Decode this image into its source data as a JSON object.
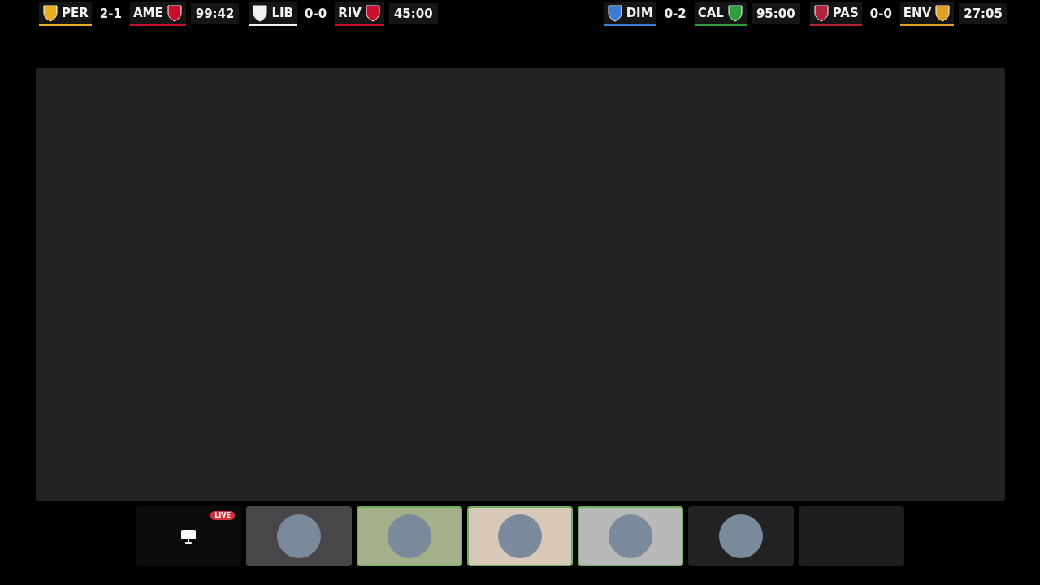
{
  "scoreboard": [
    {
      "home": {
        "abbr": "PER",
        "color": "#e8b020"
      },
      "score": "2-1",
      "away": {
        "abbr": "AME",
        "color": "#c8102e"
      },
      "clock": "99:42"
    },
    {
      "home": {
        "abbr": "LIB",
        "color": "#f2f2f2"
      },
      "score": "0-0",
      "away": {
        "abbr": "RIV",
        "color": "#c8102e"
      },
      "clock": "45:00"
    },
    {
      "home": {
        "abbr": "DIM",
        "color": "#3a7bd5"
      },
      "score": "0-2",
      "away": {
        "abbr": "CAL",
        "color": "#2e9e3e"
      },
      "clock": "95:00"
    },
    {
      "home": {
        "abbr": "PAS",
        "color": "#b0243a"
      },
      "score": "0-0",
      "away": {
        "abbr": "ENV",
        "color": "#e0a020"
      },
      "clock": "27:05"
    }
  ],
  "participants": [
    {
      "kind": "screen",
      "speaking": false,
      "color": "#0b0b0c",
      "badge": "LIVE"
    },
    {
      "kind": "avatar",
      "speaking": false,
      "color": "#484648"
    },
    {
      "kind": "avatar",
      "speaking": true,
      "color": "#a3b08a"
    },
    {
      "kind": "avatar",
      "speaking": true,
      "color": "#d8c8b8"
    },
    {
      "kind": "avatar",
      "speaking": true,
      "color": "#b9b9b9"
    },
    {
      "kind": "avatar",
      "speaking": false,
      "color": "#222222"
    },
    {
      "kind": "empty",
      "speaking": false,
      "color": "#1e1e1f"
    }
  ]
}
